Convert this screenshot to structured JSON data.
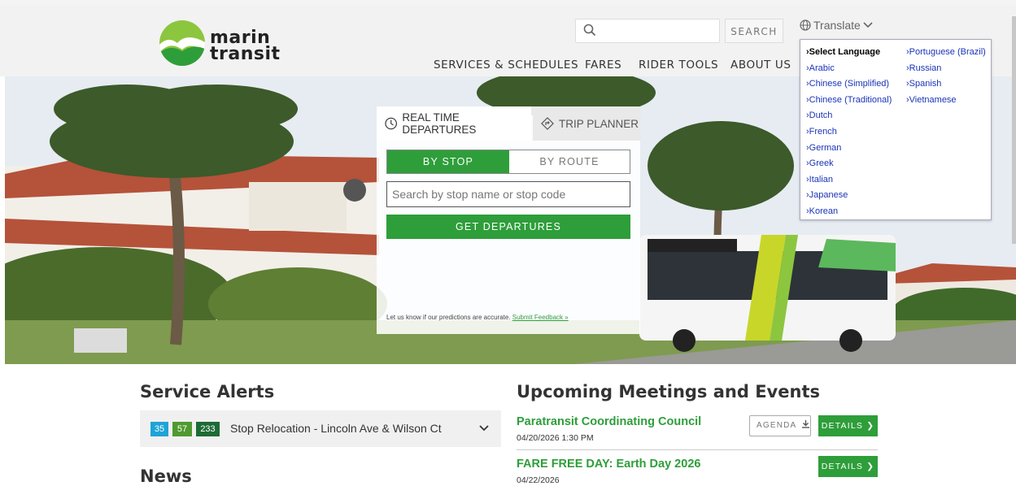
{
  "header": {
    "logo_line1": "marin",
    "logo_line2": "transit",
    "search_placeholder": "",
    "search_button": "SEARCH",
    "translate_label": "Translate"
  },
  "nav": {
    "items": [
      "SERVICES & SCHEDULES",
      "FARES",
      "RIDER TOOLS",
      "ABOUT US"
    ]
  },
  "widget": {
    "tab_realtime": "REAL TIME DEPARTURES",
    "tab_trip": "TRIP PLANNER",
    "seg_stop": "BY STOP",
    "seg_route": "BY ROUTE",
    "stop_placeholder": "Search by stop name or stop code",
    "get_button": "GET DEPARTURES",
    "feedback_text": "Let us know if our predictions are accurate.",
    "feedback_link": "Submit Feedback »"
  },
  "translate_menu": {
    "col1": [
      "›Select Language",
      "›Arabic",
      "›Chinese (Simplified)",
      "›Chinese (Traditional)",
      "›Dutch",
      "›French",
      "›German",
      "›Greek",
      "›Italian",
      "›Japanese",
      "›Korean"
    ],
    "col2": [
      "›Portuguese (Brazil)",
      "›Russian",
      "›Spanish",
      "›Vietnamese"
    ]
  },
  "service_alerts": {
    "heading": "Service Alerts",
    "badges": [
      {
        "label": "35",
        "color": "#1fa3d6"
      },
      {
        "label": "57",
        "color": "#4e9a2f"
      },
      {
        "label": "233",
        "color": "#1d6b34"
      }
    ],
    "alert_text": "Stop Relocation - Lincoln Ave & Wilson Ct"
  },
  "news": {
    "heading": "News"
  },
  "events": {
    "heading": "Upcoming Meetings and Events",
    "agenda_label": "AGENDA",
    "details_label": "DETAILS",
    "items": [
      {
        "title": "Paratransit Coordinating Council",
        "date": "04/20/2026 1:30 PM"
      },
      {
        "title": "FARE FREE DAY: Earth Day 2026",
        "date": "04/22/2026"
      }
    ]
  },
  "colors": {
    "brand_green": "#2e9e3a",
    "link_blue": "#1a33b8"
  }
}
